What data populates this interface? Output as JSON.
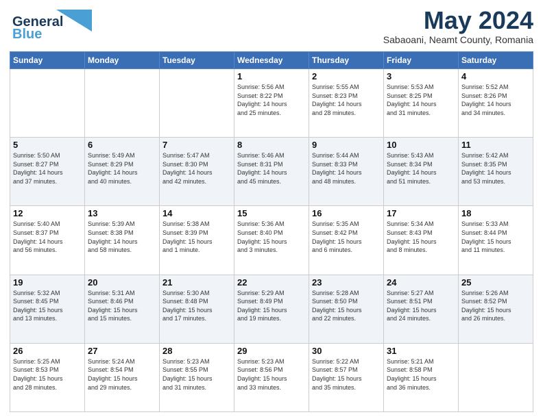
{
  "header": {
    "logo_line1": "General",
    "logo_line2": "Blue",
    "month_year": "May 2024",
    "location": "Sabaoani, Neamt County, Romania"
  },
  "weekdays": [
    "Sunday",
    "Monday",
    "Tuesday",
    "Wednesday",
    "Thursday",
    "Friday",
    "Saturday"
  ],
  "weeks": [
    [
      {
        "day": "",
        "info": ""
      },
      {
        "day": "",
        "info": ""
      },
      {
        "day": "",
        "info": ""
      },
      {
        "day": "1",
        "info": "Sunrise: 5:56 AM\nSunset: 8:22 PM\nDaylight: 14 hours\nand 25 minutes."
      },
      {
        "day": "2",
        "info": "Sunrise: 5:55 AM\nSunset: 8:23 PM\nDaylight: 14 hours\nand 28 minutes."
      },
      {
        "day": "3",
        "info": "Sunrise: 5:53 AM\nSunset: 8:25 PM\nDaylight: 14 hours\nand 31 minutes."
      },
      {
        "day": "4",
        "info": "Sunrise: 5:52 AM\nSunset: 8:26 PM\nDaylight: 14 hours\nand 34 minutes."
      }
    ],
    [
      {
        "day": "5",
        "info": "Sunrise: 5:50 AM\nSunset: 8:27 PM\nDaylight: 14 hours\nand 37 minutes."
      },
      {
        "day": "6",
        "info": "Sunrise: 5:49 AM\nSunset: 8:29 PM\nDaylight: 14 hours\nand 40 minutes."
      },
      {
        "day": "7",
        "info": "Sunrise: 5:47 AM\nSunset: 8:30 PM\nDaylight: 14 hours\nand 42 minutes."
      },
      {
        "day": "8",
        "info": "Sunrise: 5:46 AM\nSunset: 8:31 PM\nDaylight: 14 hours\nand 45 minutes."
      },
      {
        "day": "9",
        "info": "Sunrise: 5:44 AM\nSunset: 8:33 PM\nDaylight: 14 hours\nand 48 minutes."
      },
      {
        "day": "10",
        "info": "Sunrise: 5:43 AM\nSunset: 8:34 PM\nDaylight: 14 hours\nand 51 minutes."
      },
      {
        "day": "11",
        "info": "Sunrise: 5:42 AM\nSunset: 8:35 PM\nDaylight: 14 hours\nand 53 minutes."
      }
    ],
    [
      {
        "day": "12",
        "info": "Sunrise: 5:40 AM\nSunset: 8:37 PM\nDaylight: 14 hours\nand 56 minutes."
      },
      {
        "day": "13",
        "info": "Sunrise: 5:39 AM\nSunset: 8:38 PM\nDaylight: 14 hours\nand 58 minutes."
      },
      {
        "day": "14",
        "info": "Sunrise: 5:38 AM\nSunset: 8:39 PM\nDaylight: 15 hours\nand 1 minute."
      },
      {
        "day": "15",
        "info": "Sunrise: 5:36 AM\nSunset: 8:40 PM\nDaylight: 15 hours\nand 3 minutes."
      },
      {
        "day": "16",
        "info": "Sunrise: 5:35 AM\nSunset: 8:42 PM\nDaylight: 15 hours\nand 6 minutes."
      },
      {
        "day": "17",
        "info": "Sunrise: 5:34 AM\nSunset: 8:43 PM\nDaylight: 15 hours\nand 8 minutes."
      },
      {
        "day": "18",
        "info": "Sunrise: 5:33 AM\nSunset: 8:44 PM\nDaylight: 15 hours\nand 11 minutes."
      }
    ],
    [
      {
        "day": "19",
        "info": "Sunrise: 5:32 AM\nSunset: 8:45 PM\nDaylight: 15 hours\nand 13 minutes."
      },
      {
        "day": "20",
        "info": "Sunrise: 5:31 AM\nSunset: 8:46 PM\nDaylight: 15 hours\nand 15 minutes."
      },
      {
        "day": "21",
        "info": "Sunrise: 5:30 AM\nSunset: 8:48 PM\nDaylight: 15 hours\nand 17 minutes."
      },
      {
        "day": "22",
        "info": "Sunrise: 5:29 AM\nSunset: 8:49 PM\nDaylight: 15 hours\nand 19 minutes."
      },
      {
        "day": "23",
        "info": "Sunrise: 5:28 AM\nSunset: 8:50 PM\nDaylight: 15 hours\nand 22 minutes."
      },
      {
        "day": "24",
        "info": "Sunrise: 5:27 AM\nSunset: 8:51 PM\nDaylight: 15 hours\nand 24 minutes."
      },
      {
        "day": "25",
        "info": "Sunrise: 5:26 AM\nSunset: 8:52 PM\nDaylight: 15 hours\nand 26 minutes."
      }
    ],
    [
      {
        "day": "26",
        "info": "Sunrise: 5:25 AM\nSunset: 8:53 PM\nDaylight: 15 hours\nand 28 minutes."
      },
      {
        "day": "27",
        "info": "Sunrise: 5:24 AM\nSunset: 8:54 PM\nDaylight: 15 hours\nand 29 minutes."
      },
      {
        "day": "28",
        "info": "Sunrise: 5:23 AM\nSunset: 8:55 PM\nDaylight: 15 hours\nand 31 minutes."
      },
      {
        "day": "29",
        "info": "Sunrise: 5:23 AM\nSunset: 8:56 PM\nDaylight: 15 hours\nand 33 minutes."
      },
      {
        "day": "30",
        "info": "Sunrise: 5:22 AM\nSunset: 8:57 PM\nDaylight: 15 hours\nand 35 minutes."
      },
      {
        "day": "31",
        "info": "Sunrise: 5:21 AM\nSunset: 8:58 PM\nDaylight: 15 hours\nand 36 minutes."
      },
      {
        "day": "",
        "info": ""
      }
    ]
  ]
}
